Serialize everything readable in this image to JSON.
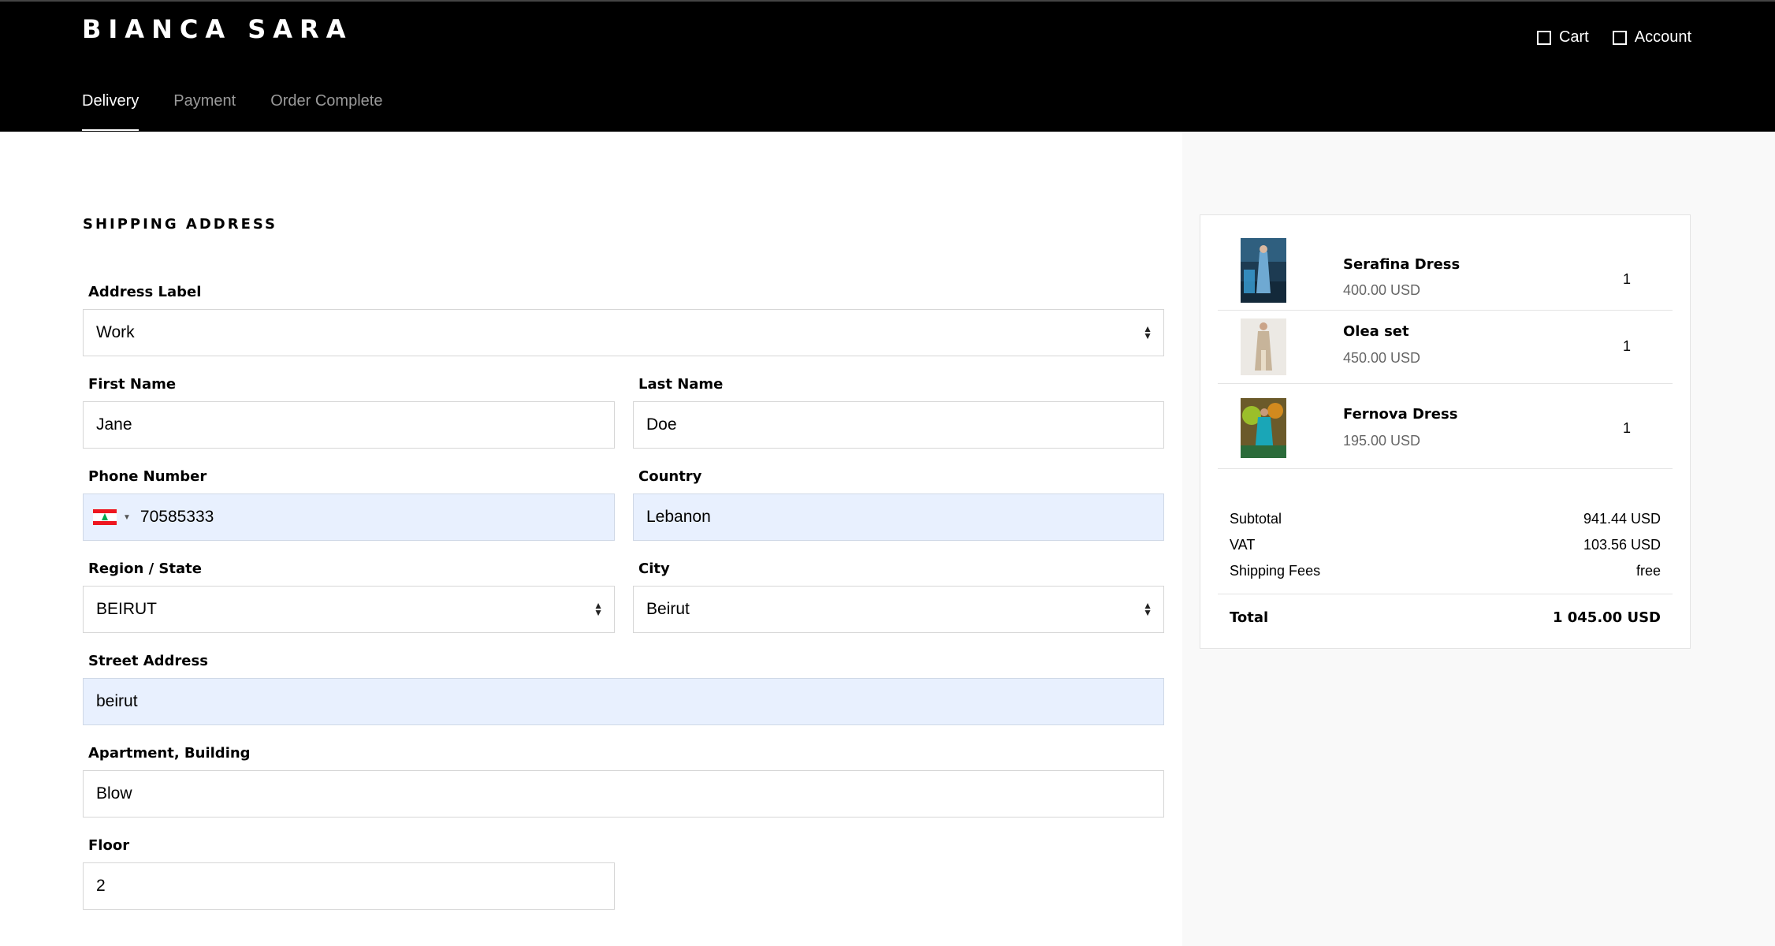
{
  "header": {
    "brand": "BIANCA SARA",
    "cart_label": "Cart",
    "account_label": "Account",
    "steps": [
      {
        "label": "Delivery"
      },
      {
        "label": "Payment"
      },
      {
        "label": "Order Complete"
      }
    ]
  },
  "form": {
    "section_title": "SHIPPING ADDRESS",
    "address_label": {
      "label": "Address Label",
      "value": "Work"
    },
    "first_name": {
      "label": "First Name",
      "value": "Jane"
    },
    "last_name": {
      "label": "Last Name",
      "value": "Doe"
    },
    "phone": {
      "label": "Phone Number",
      "value": "70585333"
    },
    "country": {
      "label": "Country",
      "value": "Lebanon"
    },
    "region": {
      "label": "Region / State",
      "value": "BEIRUT"
    },
    "city": {
      "label": "City",
      "value": "Beirut"
    },
    "street": {
      "label": "Street Address",
      "value": "beirut"
    },
    "apartment": {
      "label": "Apartment, Building",
      "value": "Blow"
    },
    "floor": {
      "label": "Floor",
      "value": "2"
    }
  },
  "summary": {
    "items": [
      {
        "name": "Serafina Dress",
        "price": "400.00 USD",
        "qty": "1"
      },
      {
        "name": "Olea set",
        "price": "450.00 USD",
        "qty": "1"
      },
      {
        "name": "Fernova Dress",
        "price": "195.00 USD",
        "qty": "1"
      }
    ],
    "subtotal": {
      "label": "Subtotal",
      "value": "941.44 USD"
    },
    "vat": {
      "label": "VAT",
      "value": "103.56 USD"
    },
    "shipping": {
      "label": "Shipping Fees",
      "value": "free"
    },
    "total": {
      "label": "Total",
      "value": "1 045.00 USD"
    }
  },
  "colors": {
    "header_bg": "#000000",
    "autofill_bg": "#e8f0fe",
    "summary_bg": "#f9f9f9"
  }
}
